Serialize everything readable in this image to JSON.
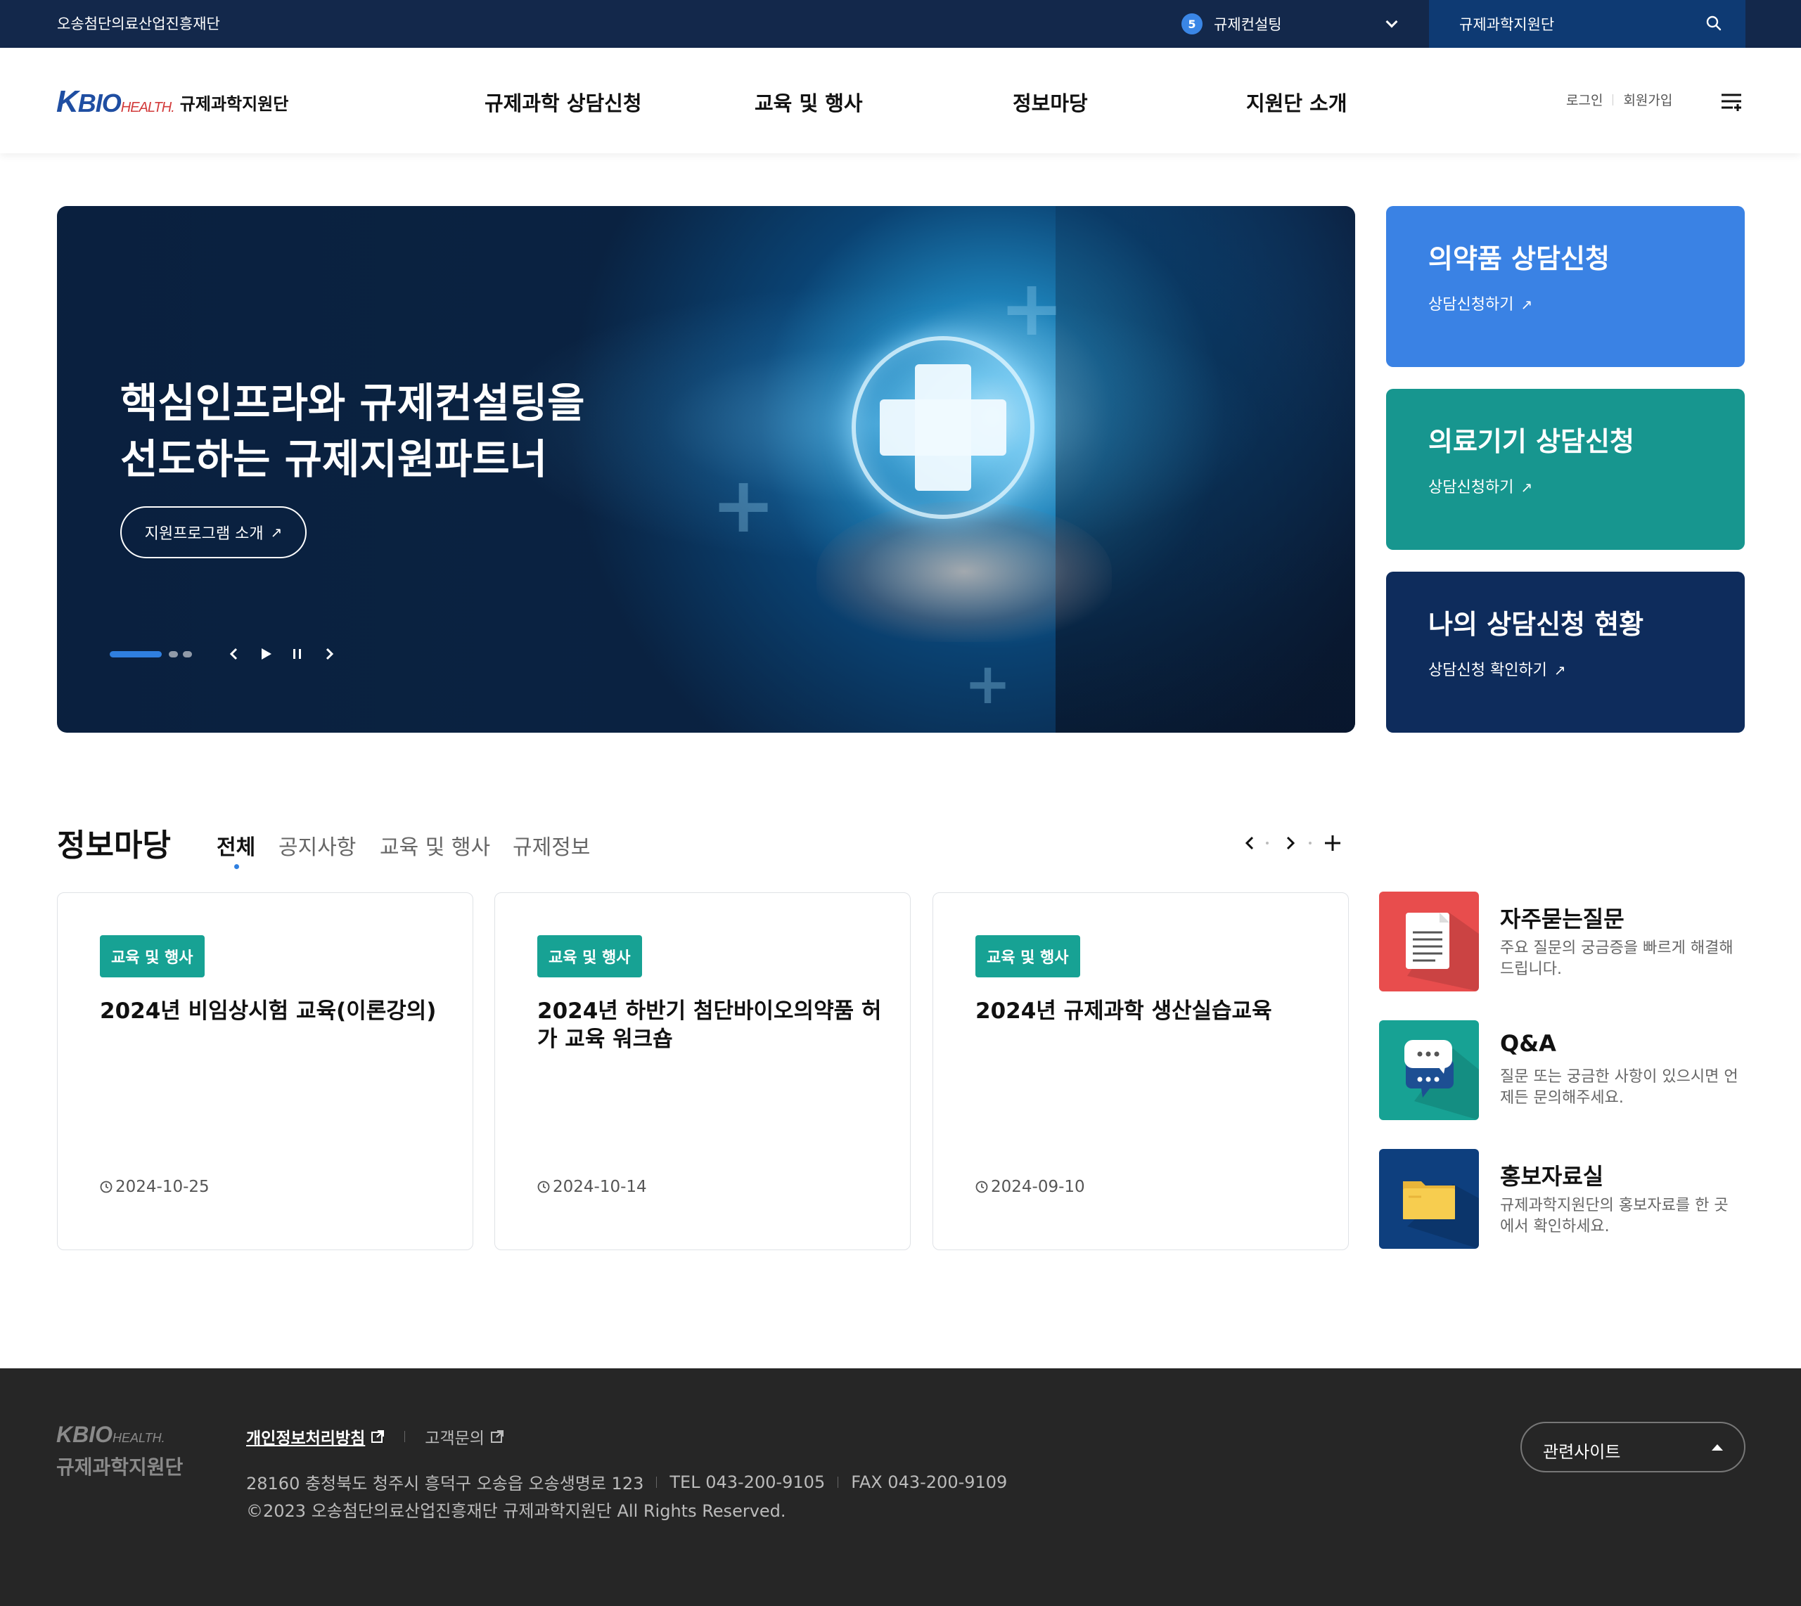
{
  "topbar": {
    "org_name": "오송첨단의료산업진흥재단",
    "consult_badge": "5",
    "consult_label": "규제컨설팅",
    "search_label": "규제과학지원단"
  },
  "header": {
    "logo_mark_k": "K",
    "logo_mark_bio": "BIO",
    "logo_mark_health": "HEALTH.",
    "logo_name": "규제과학지원단",
    "nav": [
      "규제과학 상담신청",
      "교육 및 행사",
      "정보마당",
      "지원단 소개"
    ],
    "login": "로그인",
    "signup": "회원가입"
  },
  "hero": {
    "title_bold_1": "핵심인프라와 규제컨설팅",
    "title_rest_1": "을",
    "title_line_2": "선도하는 규제지원파트너",
    "button_label": "지원프로그램 소개"
  },
  "quick_cards": [
    {
      "title": "의약품 상담신청",
      "link": "상담신청하기",
      "color": "#3a82e4"
    },
    {
      "title": "의료기기 상담신청",
      "link": "상담신청하기",
      "color": "#17968f"
    },
    {
      "title": "나의 상담신청 현황",
      "link": "상담신청 확인하기",
      "color": "#0e2c5c"
    }
  ],
  "board": {
    "title": "정보마당",
    "tabs": [
      "전체",
      "공지사항",
      "교육 및 행사",
      "규제정보"
    ],
    "active_tab": "전체",
    "cards": [
      {
        "category": "교육 및 행사",
        "title": "2024년 비임상시험 교육(이론강의)",
        "date": "2024-10-25"
      },
      {
        "category": "교육 및 행사",
        "title": "2024년 하반기 첨단바이오의약품 허가 교육 워크숍",
        "date": "2024-10-14"
      },
      {
        "category": "교육 및 행사",
        "title": "2024년 규제과학 생산실습교육",
        "date": "2024-09-10"
      }
    ]
  },
  "side_links": [
    {
      "title": "자주묻는질문",
      "desc": "주요 질문의 궁금증을 빠르게 해결해 드립니다.",
      "icon": "document-icon",
      "color": "#e84d4d"
    },
    {
      "title": "Q&A",
      "desc": "질문 또는 궁금한 사항이 있으시면 언제든 문의해주세요.",
      "icon": "chat-bubbles-icon",
      "color": "#17a294"
    },
    {
      "title": "홍보자료실",
      "desc": "규제과학지원단의 홍보자료를 한 곳에서 확인하세요.",
      "icon": "folder-icon",
      "color": "#0e3f7e"
    }
  ],
  "footer": {
    "logo_mark": "BIO",
    "logo_health": "HEALTH.",
    "logo_name": "규제과학지원단",
    "privacy": "개인정보처리방침",
    "contact": "고객문의",
    "address": "28160 충청북도 청주시 흥덕구 오송읍 오송생명로 123",
    "tel": "TEL 043-200-9105",
    "fax": "FAX 043-200-9109",
    "copyright": "©2023 오송첨단의료산업진흥재단 규제과학지원단 All Rights Reserved.",
    "related_label": "관련사이트"
  }
}
